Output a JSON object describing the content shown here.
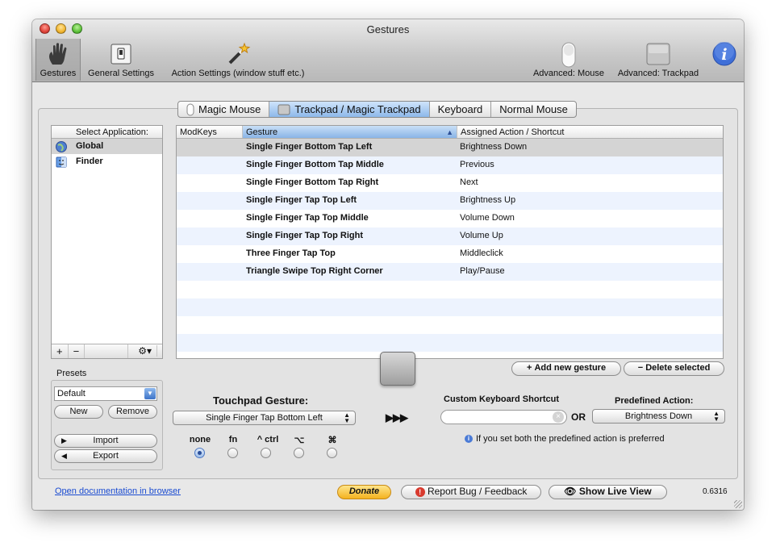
{
  "window": {
    "title": "Gestures"
  },
  "toolbar": {
    "items": [
      {
        "label": "Gestures",
        "icon": "hand-icon"
      },
      {
        "label": "General Settings",
        "icon": "switch-icon"
      },
      {
        "label": "Action Settings (window stuff etc.)",
        "icon": "magic-wand-icon"
      },
      {
        "label": "Advanced: Mouse",
        "icon": "mouse-icon"
      },
      {
        "label": "Advanced: Trackpad",
        "icon": "trackpad-icon"
      },
      {
        "label": "",
        "icon": "info-icon"
      }
    ]
  },
  "device_tabs": [
    "Magic Mouse",
    "Trackpad / Magic Trackpad",
    "Keyboard",
    "Normal Mouse"
  ],
  "device_tabs_selected": "Trackpad / Magic Trackpad",
  "apps": {
    "header": "Select Application:",
    "items": [
      "Global",
      "Finder"
    ],
    "selected": "Global"
  },
  "presets": {
    "label": "Presets",
    "value": "Default",
    "new_label": "New",
    "remove_label": "Remove",
    "import_label": "Import",
    "export_label": "Export"
  },
  "table": {
    "columns": [
      "ModKeys",
      "Gesture",
      "Assigned Action / Shortcut"
    ],
    "rows": [
      {
        "modkeys": "",
        "gesture": "Single Finger Bottom Tap Left",
        "action": "Brightness Down"
      },
      {
        "modkeys": "",
        "gesture": "Single Finger Bottom Tap Middle",
        "action": "Previous"
      },
      {
        "modkeys": "",
        "gesture": "Single Finger Bottom Tap Right",
        "action": "Next"
      },
      {
        "modkeys": "",
        "gesture": "Single Finger Tap Top Left",
        "action": "Brightness Up"
      },
      {
        "modkeys": "",
        "gesture": "Single Finger Tap Top Middle",
        "action": "Volume Down"
      },
      {
        "modkeys": "",
        "gesture": "Single Finger Tap Top Right",
        "action": "Volume Up"
      },
      {
        "modkeys": "",
        "gesture": "Three Finger Tap Top",
        "action": "Middleclick"
      },
      {
        "modkeys": "",
        "gesture": "Triangle Swipe Top Right Corner",
        "action": "Play/Pause"
      }
    ]
  },
  "actions": {
    "add_label": "Add new gesture",
    "delete_label": "Delete selected"
  },
  "editor": {
    "gesture_label": "Touchpad Gesture:",
    "gesture_value": "Single Finger Tap Bottom Left",
    "arrows": "▶▶▶",
    "shortcut_label": "Custom Keyboard Shortcut",
    "or_label": "OR",
    "predefined_label": "Predefined Action:",
    "predefined_value": "Brightness Down",
    "hint": "If you set both the predefined action is preferred",
    "modifiers": [
      "none",
      "fn",
      "^ ctrl",
      "⌥",
      "⌘"
    ],
    "modifier_selected": "none"
  },
  "footer": {
    "doc_link": "Open documentation in browser",
    "donate_label": "Donate",
    "report_label": "Report Bug / Feedback",
    "live_view_label": "Show Live View",
    "version": "0.6316"
  }
}
